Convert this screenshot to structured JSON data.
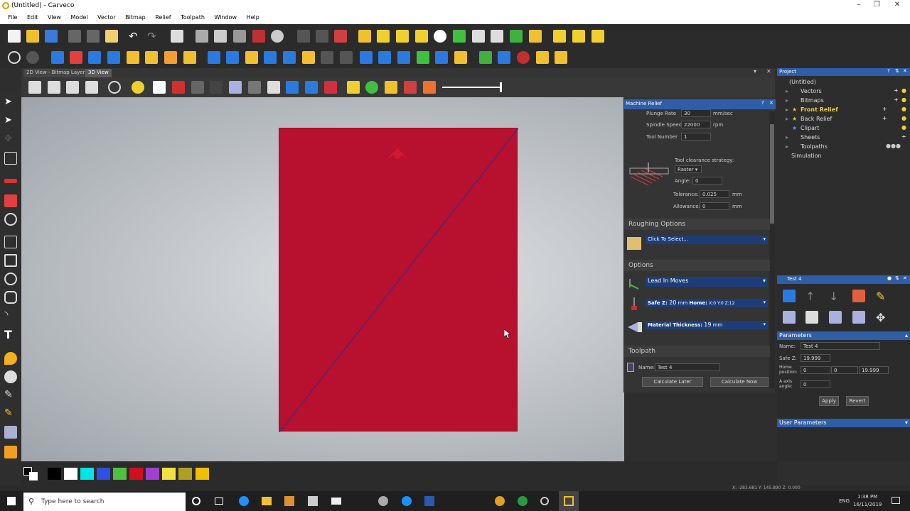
{
  "window": {
    "title": "(Untitled) - Carveco"
  },
  "menu": [
    "File",
    "Edit",
    "View",
    "Model",
    "Vector",
    "Bitmap",
    "Relief",
    "Toolpath",
    "Window",
    "Help"
  ],
  "tabs": {
    "bitmap": "2D View - Bitmap Layer",
    "view3d": "3D View"
  },
  "machine_relief": {
    "title": "Machine Relief",
    "plunge_label": "Plunge Rate",
    "plunge_value": "30",
    "plunge_unit": "mm/sec",
    "spindle_label": "Spindle Speed",
    "spindle_value": "22000",
    "spindle_unit": "rpm",
    "toolnum_label": "Tool Number",
    "toolnum_value": "1",
    "clearance_label": "Tool clearance strategy:",
    "clearance_value": "Raster",
    "angle_label": "Angle:",
    "angle_value": "0",
    "tolerance_label": "Tolerance:",
    "tolerance_value": "0.025",
    "tolerance_unit": "mm",
    "allowance_label": "Allowance:",
    "allowance_value": "0",
    "allowance_unit": "mm",
    "roughing_title": "Roughing Options",
    "roughing_select": "Click To Select...",
    "options_title": "Options",
    "lead_in": "Lead In Moves",
    "safez_label": "Safe Z:",
    "safez_value": "20",
    "safez_unit": "mm",
    "home_label": "Home:",
    "home_value": "X:0 Y:0 Z:12",
    "material_label": "Material Thickness:",
    "material_value": "19",
    "material_unit": "mm",
    "toolpath_title": "Toolpath",
    "name_label": "Name:",
    "name_value": "Test 4",
    "calc_later": "Calculate Later",
    "calc_now": "Calculate Now"
  },
  "project": {
    "title": "Project",
    "items": [
      "(Untitled)",
      "Vectors",
      "Bitmaps",
      "Front Relief",
      "Back Relief",
      "Clipart",
      "Sheets",
      "Toolpaths",
      "Simulation"
    ]
  },
  "test_panel": {
    "title": "Test 4",
    "parameters_title": "Parameters",
    "name_label": "Name:",
    "name_value": "Test 4",
    "safez_label": "Safe Z:",
    "safez_value": "19.999",
    "home_label_1": "Home",
    "home_label_2": "position:",
    "home_x": "0",
    "home_y": "0",
    "home_z": "19.999",
    "aaxis_label_1": "A axis",
    "aaxis_label_2": "angle:",
    "aaxis_value": "0",
    "apply": "Apply",
    "revert": "Revert",
    "user_params": "User Parameters"
  },
  "status": {
    "coords": "X: -283.681   Y: 145.890   Z: 0.000"
  },
  "taskbar": {
    "search_placeholder": "Type here to search",
    "lang": "ENG",
    "time": "1:38 PM",
    "date": "16/11/2019"
  },
  "palette": [
    "#000000",
    "#ffffff",
    "#00e5e5",
    "#3050e0",
    "#50c040",
    "#d01020",
    "#a040d0",
    "#f0e040",
    "#b0a020",
    "#f0c000"
  ]
}
